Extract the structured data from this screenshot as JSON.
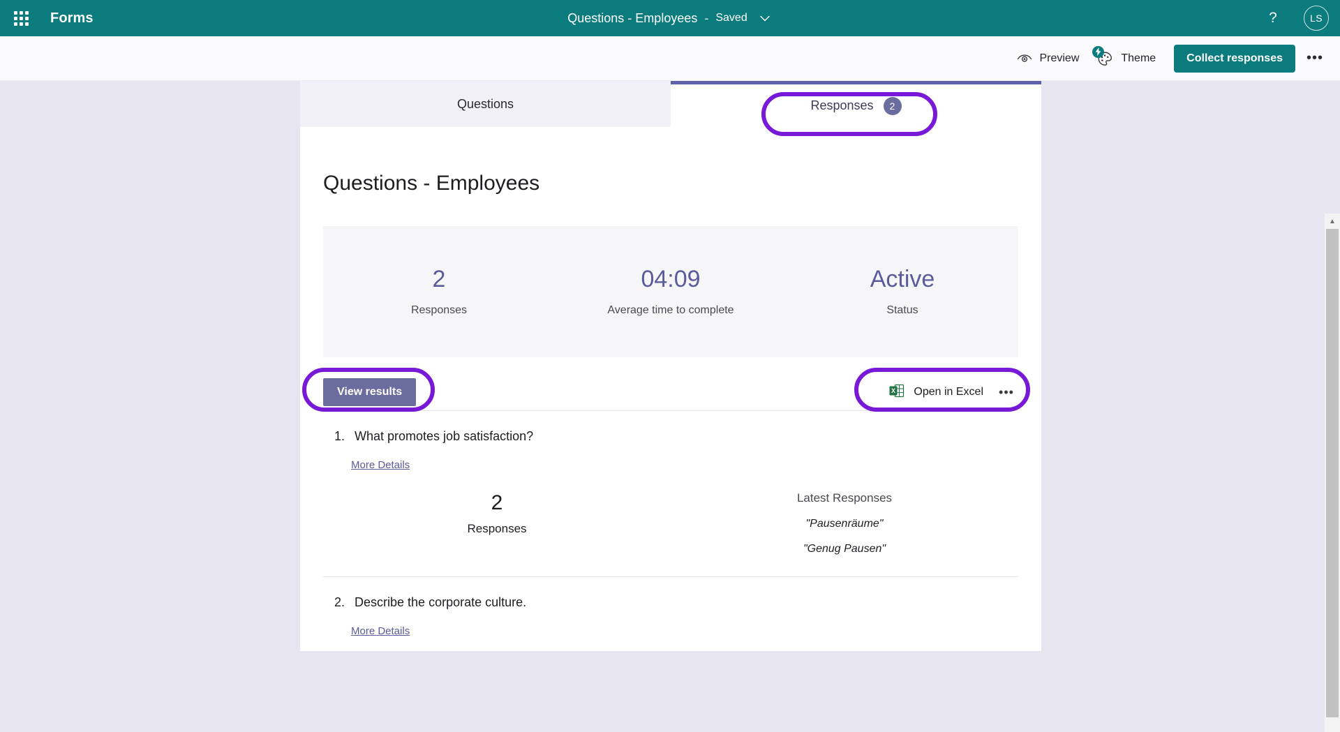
{
  "suitebar": {
    "waffle_label": "app-launcher",
    "brand": "Forms",
    "doc_title": "Questions - Employees",
    "separator": "-",
    "save_state": "Saved",
    "help_glyph": "?",
    "avatar_initials": "LS"
  },
  "commandbar": {
    "preview_label": "Preview",
    "theme_label": "Theme",
    "collect_label": "Collect responses",
    "more_glyph": "•••"
  },
  "tabs": [
    {
      "label": "Questions",
      "badge": "",
      "active": false
    },
    {
      "label": "Responses",
      "badge": "2",
      "active": true
    }
  ],
  "main": {
    "form_title": "Questions - Employees",
    "stats": [
      {
        "value": "2",
        "label": "Responses"
      },
      {
        "value": "04:09",
        "label": "Average time to complete"
      },
      {
        "value": "Active",
        "label": "Status"
      }
    ],
    "view_results_label": "View results",
    "open_in_excel_label": "Open in Excel",
    "excel_more_glyph": "•••",
    "questions": [
      {
        "number": "1.",
        "text": "What promotes job satisfaction?",
        "more_details": "More Details",
        "response_count": "2",
        "response_count_label": "Responses",
        "latest_heading": "Latest Responses",
        "latest": [
          "\"Pausenräume\"",
          "\"Genug Pausen\""
        ]
      },
      {
        "number": "2.",
        "text": "Describe the corporate culture.",
        "more_details": "More Details"
      }
    ]
  },
  "colors": {
    "suite_teal": "#0c7b7e",
    "accent_purple": "#5f61a8",
    "button_purple": "#6b6d9e",
    "annotation_purple": "#7719d6",
    "page_bg": "#e7e6f0",
    "excel_green": "#217346"
  },
  "scrollbar": {
    "up_arrow": "▲"
  }
}
